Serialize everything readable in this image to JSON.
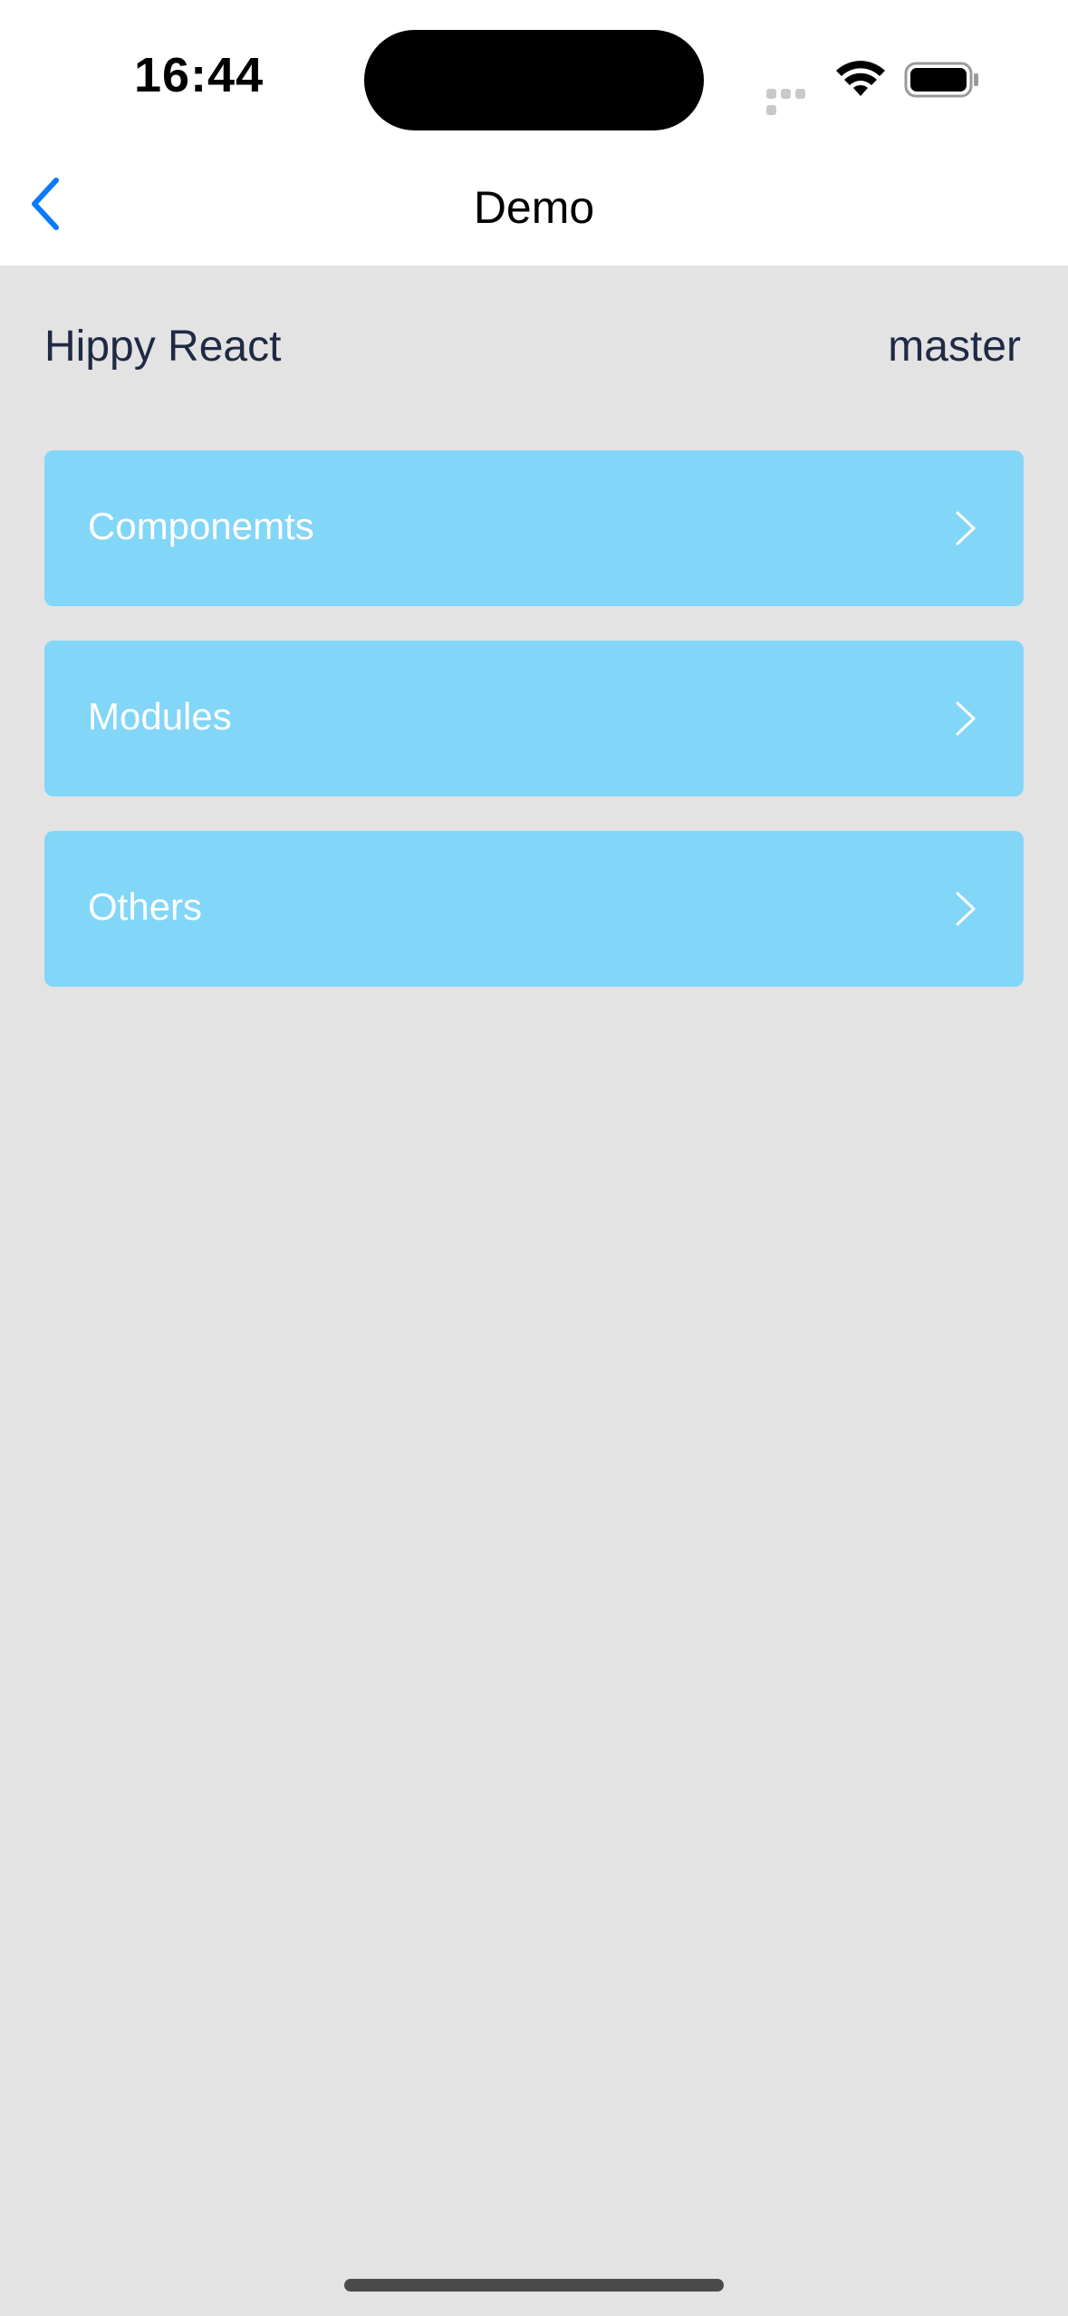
{
  "status_bar": {
    "time": "16:44"
  },
  "nav": {
    "title": "Demo",
    "back_icon": "chevron-left-icon",
    "accent_color": "#0a7aff"
  },
  "info": {
    "app_name": "Hippy React",
    "branch": "master"
  },
  "menu": {
    "background_color": "#82d6f8",
    "items": [
      {
        "label": "Componemts",
        "icon": "chevron-right-icon"
      },
      {
        "label": "Modules",
        "icon": "chevron-right-icon"
      },
      {
        "label": "Others",
        "icon": "chevron-right-icon"
      }
    ]
  }
}
